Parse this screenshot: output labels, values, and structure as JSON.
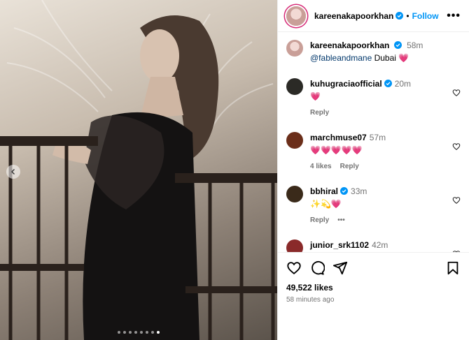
{
  "post": {
    "carousel_total": 8,
    "carousel_active_index": 7
  },
  "header": {
    "username": "kareenakapoorkhan",
    "separator": "•",
    "follow_label": "Follow",
    "more_label": "•••"
  },
  "caption": {
    "username": "kareenakapoorkhan",
    "time": "58m",
    "mention": "@fableandmane",
    "text": " Dubai ",
    "emoji": "💗"
  },
  "comments": [
    {
      "username": "kuhugraciaofficial",
      "verified": true,
      "time": "20m",
      "text": "💗",
      "likes": "",
      "reply_label": "Reply",
      "avatar_color": "#2b2a26"
    },
    {
      "username": "marchmuse07",
      "verified": false,
      "time": "57m",
      "text": "💗💗💗💗💗",
      "likes": "4 likes",
      "reply_label": "Reply",
      "avatar_color": "#6b2e1a"
    },
    {
      "username": "bbhiral",
      "verified": true,
      "time": "33m",
      "text": "✨💫💗",
      "likes": "",
      "reply_label": "Reply",
      "more_label": "•••",
      "avatar_color": "#3a2a1a"
    },
    {
      "username": "junior_srk1102",
      "verified": false,
      "time": "42m",
      "text": "😘🤍",
      "likes": "",
      "reply_label": "",
      "avatar_color": "#8a2a2a"
    }
  ],
  "footer": {
    "likes": "49,522 likes",
    "time_ago": "58 minutes ago"
  },
  "colors": {
    "accent": "#0095f6",
    "verified": "#0095f6",
    "muted": "#737373",
    "story_ring": "#d62976"
  },
  "icons": [
    "chevron-left-icon",
    "verified-icon",
    "heart-icon",
    "comment-icon",
    "share-icon",
    "bookmark-icon",
    "more-icon"
  ]
}
